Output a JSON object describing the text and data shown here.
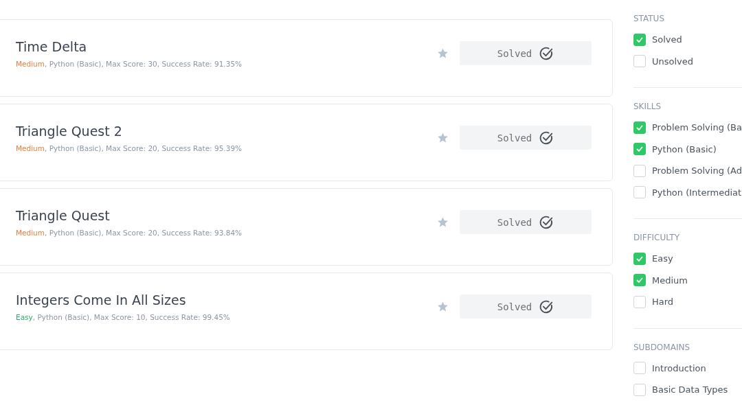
{
  "challenges": [
    {
      "title": "Time Delta",
      "difficulty": {
        "label": "Medium",
        "color": "#e87e3b"
      },
      "details": ", Python (Basic), Max Score: 30, Success Rate: 91.35%",
      "starred": false,
      "action": "Solved"
    },
    {
      "title": "Triangle Quest 2",
      "difficulty": {
        "label": "Medium",
        "color": "#e87e3b"
      },
      "details": ", Python (Basic), Max Score: 20, Success Rate: 95.39%",
      "starred": false,
      "action": "Solved"
    },
    {
      "title": "Triangle Quest",
      "difficulty": {
        "label": "Medium",
        "color": "#e87e3b"
      },
      "details": ", Python (Basic), Max Score: 20, Success Rate: 93.84%",
      "starred": false,
      "action": "Solved"
    },
    {
      "title": "Integers Come In All Sizes",
      "difficulty": {
        "label": "Easy",
        "color": "#2ea86a"
      },
      "details": ", Python (Basic), Max Score: 10, Success Rate: 99.45%",
      "starred": false,
      "action": "Solved"
    }
  ],
  "filters": [
    {
      "heading": "STATUS",
      "options": [
        {
          "label": "Solved",
          "checked": true
        },
        {
          "label": "Unsolved",
          "checked": false
        }
      ]
    },
    {
      "heading": "SKILLS",
      "options": [
        {
          "label": "Problem Solving (Ba",
          "checked": true
        },
        {
          "label": "Python (Basic)",
          "checked": true
        },
        {
          "label": "Problem Solving (Ad",
          "checked": false
        },
        {
          "label": "Python (Intermediat",
          "checked": false
        }
      ]
    },
    {
      "heading": "DIFFICULTY",
      "options": [
        {
          "label": "Easy",
          "checked": true
        },
        {
          "label": "Medium",
          "checked": true
        },
        {
          "label": "Hard",
          "checked": false
        }
      ]
    },
    {
      "heading": "SUBDOMAINS",
      "options": [
        {
          "label": "Introduction",
          "checked": false
        },
        {
          "label": "Basic Data Types",
          "checked": false
        }
      ]
    }
  ]
}
